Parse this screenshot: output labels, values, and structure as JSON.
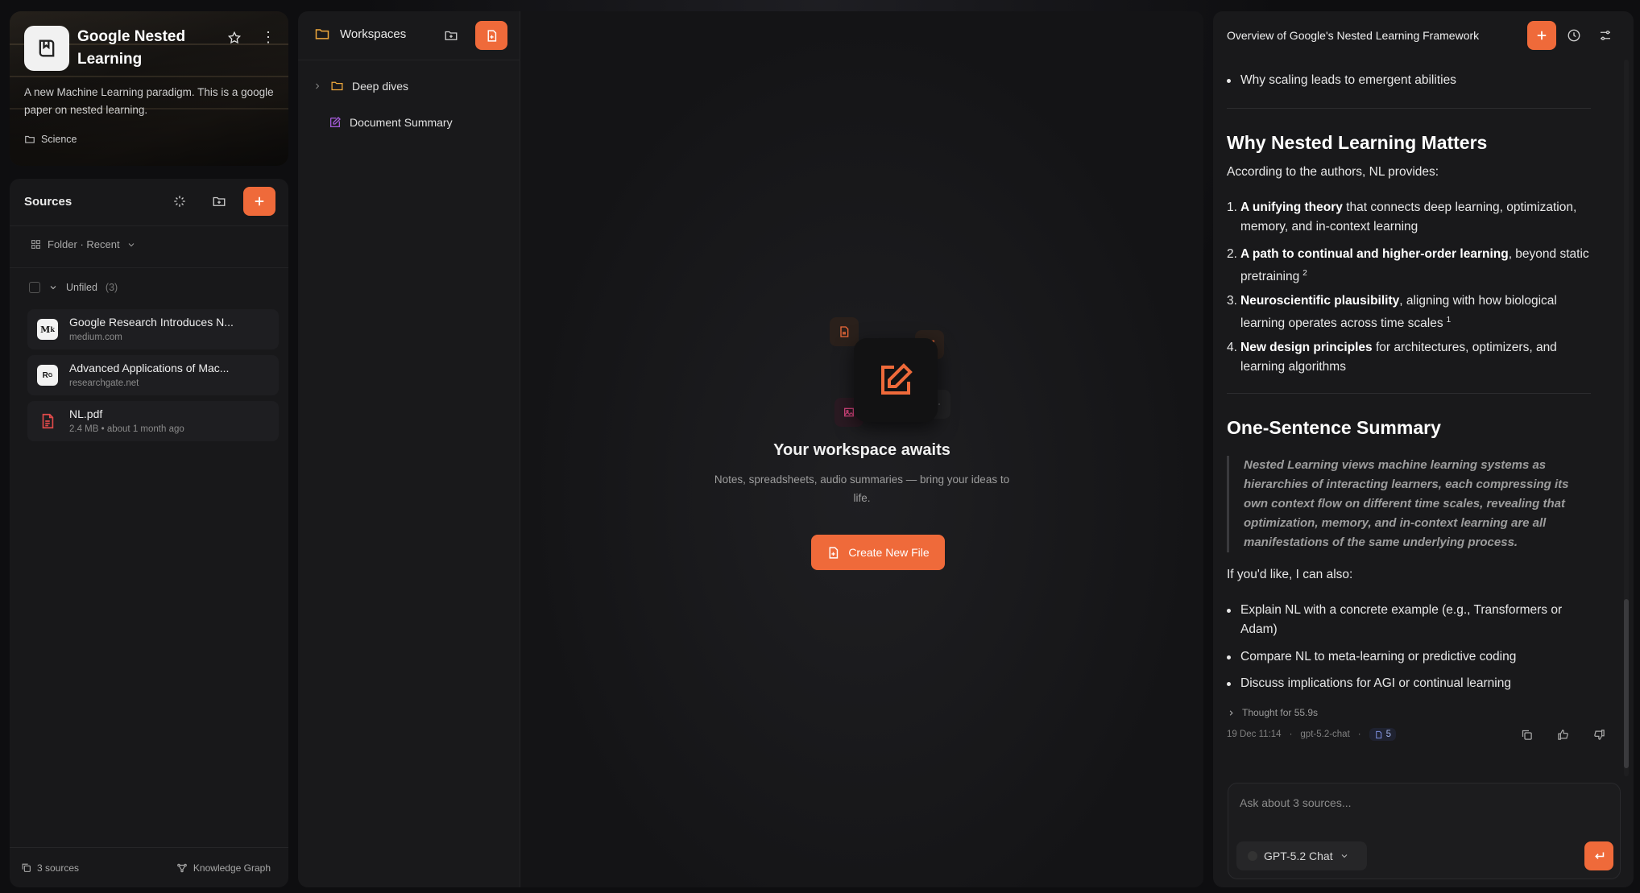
{
  "project": {
    "title": "Google Nested Learning",
    "description": "A new Machine Learning paradigm. This is a google paper on nested learning.",
    "tag": "Science",
    "more_label": "⋮"
  },
  "sources": {
    "header": "Sources",
    "filter_label": "Folder · Recent",
    "group_label": "Unfiled",
    "group_count": "(3)",
    "items": [
      {
        "title": "Google Research Introduces N...",
        "subtitle": "medium.com",
        "icon": "M̸"
      },
      {
        "title": "Advanced Applications of Mac...",
        "subtitle": "researchgate.net",
        "icon": "RG"
      },
      {
        "title": "NL.pdf",
        "subtitle": "2.4 MB • about 1 month ago",
        "icon": "pdf-icon"
      }
    ],
    "footer_count": "3 sources",
    "footer_graph": "Knowledge Graph"
  },
  "workspaces": {
    "header": "Workspaces",
    "items": [
      {
        "label": "Deep dives",
        "type": "folder"
      },
      {
        "label": "Document Summary",
        "type": "document"
      }
    ],
    "empty_title": "Your workspace awaits",
    "empty_subtitle": "Notes, spreadsheets, audio summaries — bring your ideas to life.",
    "create_label": "Create New File"
  },
  "chat": {
    "title": "Overview of Google's Nested Learning Framework",
    "top_bullet": "Why scaling leads to emergent abilities",
    "section1_title": "Why Nested Learning Matters",
    "section1_intro": "According to the authors, NL provides:",
    "list": [
      {
        "num": "1.",
        "bold": "A unifying theory",
        "rest": " that connects deep learning, optimization, memory, and in-context learning",
        "sup": ""
      },
      {
        "num": "2.",
        "bold": "A path to continual and higher-order learning",
        "rest": ", beyond static pretraining",
        "sup": "2"
      },
      {
        "num": "3.",
        "bold": "Neuroscientific plausibility",
        "rest": ", aligning with how biological learning operates across time scales",
        "sup": "1"
      },
      {
        "num": "4.",
        "bold": "New design principles",
        "rest": " for architectures, optimizers, and learning algorithms",
        "sup": ""
      }
    ],
    "section2_title": "One-Sentence Summary",
    "quote": "Nested Learning views machine learning systems as hierarchies of interacting learners, each compressing its own context flow on different time scales, revealing that optimization, memory, and in-context learning are all manifestations of the same underlying process.",
    "followup_intro": "If you'd like, I can also:",
    "followups": [
      "Explain NL with a concrete example (e.g., Transformers or Adam)",
      "Compare NL to meta-learning or predictive coding",
      "Discuss implications for AGI or continual learning"
    ],
    "thought": "Thought for 55.9s",
    "timestamp": "19 Dec 11:14",
    "model_tag": "gpt-5.2-chat",
    "source_count": "5",
    "input_placeholder": "Ask about 3 sources...",
    "model_select": "GPT-5.2 Chat"
  },
  "colors": {
    "accent": "#ef6a3a",
    "panel": "#18181a",
    "background": "#0e0e10"
  }
}
